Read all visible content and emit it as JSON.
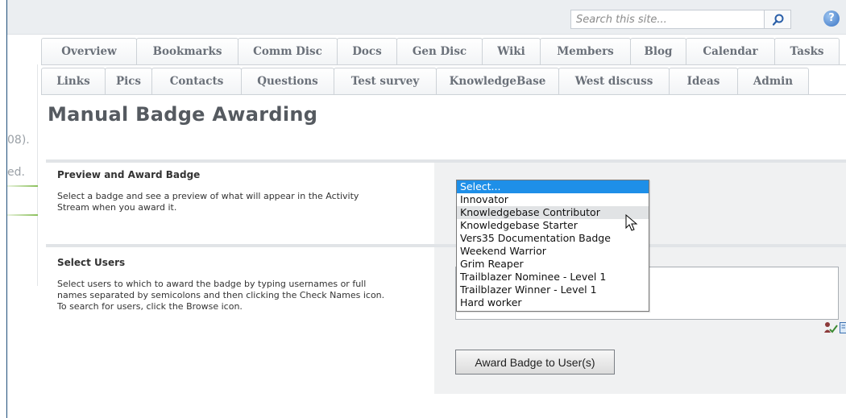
{
  "search": {
    "placeholder": "Search this site..."
  },
  "tabs_row1": [
    "Overview",
    "Bookmarks",
    "Comm Disc",
    "Docs",
    "Gen Disc",
    "Wiki",
    "Members",
    "Blog",
    "Calendar",
    "Tasks"
  ],
  "tabs_row2": [
    "Links",
    "Pics",
    "Contacts",
    "Questions",
    "Test survey",
    "KnowledgeBase",
    "West discuss",
    "Ideas",
    "Admin"
  ],
  "left_fragments": {
    "f1": "08).",
    "f2": "ed."
  },
  "page": {
    "title": "Manual Badge Awarding"
  },
  "preview_section": {
    "heading": "Preview and Award Badge",
    "desc_line1": "Select a badge and see a preview of what will appear in the Activity",
    "desc_line2": "Stream when you award it."
  },
  "users_section": {
    "heading": "Select Users",
    "desc_line1": "Select users to which to award the badge by typing usernames or full",
    "desc_line2": "names separated by semicolons and then clicking the Check Names icon.",
    "desc_line3": "To search for users, click the Browse icon."
  },
  "badge_dropdown": {
    "options": [
      "Select...",
      "Innovator",
      "Knowledgebase Contributor",
      "Knowledgebase Starter",
      "Vers35 Documentation Badge",
      "Weekend Warrior",
      "Grim Reaper",
      "Trailblazer Nominee - Level 1",
      "Trailblazer Winner - Level 1",
      "Hard worker"
    ],
    "selected_index": 0,
    "hover_index": 2
  },
  "award_button": {
    "label": "Award Badge to User(s)"
  },
  "help_icon": {
    "glyph": "?"
  },
  "colors": {
    "selected": "#1e8fe8",
    "frame": "#1e4e79",
    "hover": "#e1e3e5"
  },
  "icons": [
    "search-icon",
    "help-icon",
    "check-names-icon",
    "browse-icon",
    "pointer-cursor-icon"
  ]
}
